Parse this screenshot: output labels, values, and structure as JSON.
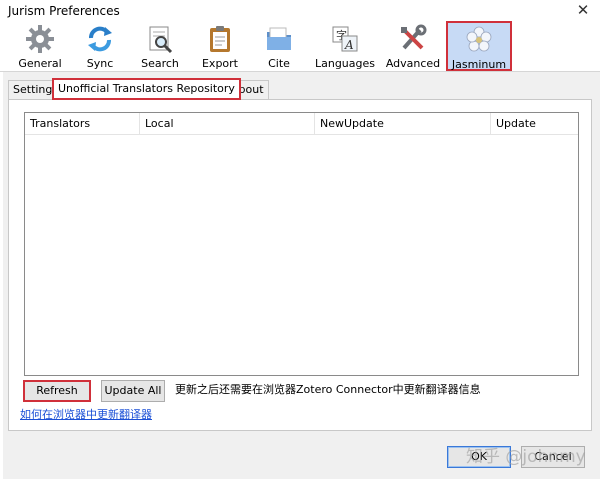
{
  "window": {
    "title": "Jurism Preferences",
    "close_glyph": "✕"
  },
  "toolbar": {
    "panes": [
      {
        "label": "General",
        "icon": "gear-icon"
      },
      {
        "label": "Sync",
        "icon": "sync-icon"
      },
      {
        "label": "Search",
        "icon": "search-icon"
      },
      {
        "label": "Export",
        "icon": "clipboard-icon"
      },
      {
        "label": "Cite",
        "icon": "folder-icon"
      },
      {
        "label": "Languages",
        "icon": "language-icon"
      },
      {
        "label": "Advanced",
        "icon": "tools-icon"
      },
      {
        "label": "Jasminum",
        "icon": "flower-icon"
      }
    ],
    "selected": "Jasminum"
  },
  "tabs": [
    {
      "label": "Setting"
    },
    {
      "label": "Unofficial Translators Repository"
    },
    {
      "label": "About"
    }
  ],
  "table": {
    "columns": [
      "Translators",
      "Local",
      "NewUpdate",
      "Update"
    ],
    "rows": []
  },
  "actions": {
    "refresh_label": "Refresh",
    "update_all_label": "Update All",
    "note": "更新之后还需要在浏览器Zotero Connector中更新翻译器信息",
    "link": "如何在浏览器中更新翻译器"
  },
  "footer": {
    "ok_label": "OK",
    "cancel_label": "Cancel"
  },
  "watermark": "知乎 @johnmy",
  "colors": {
    "highlight_border": "#d0303a",
    "selected_pane_bg": "#c7daf5",
    "link": "#1a4fd6"
  }
}
